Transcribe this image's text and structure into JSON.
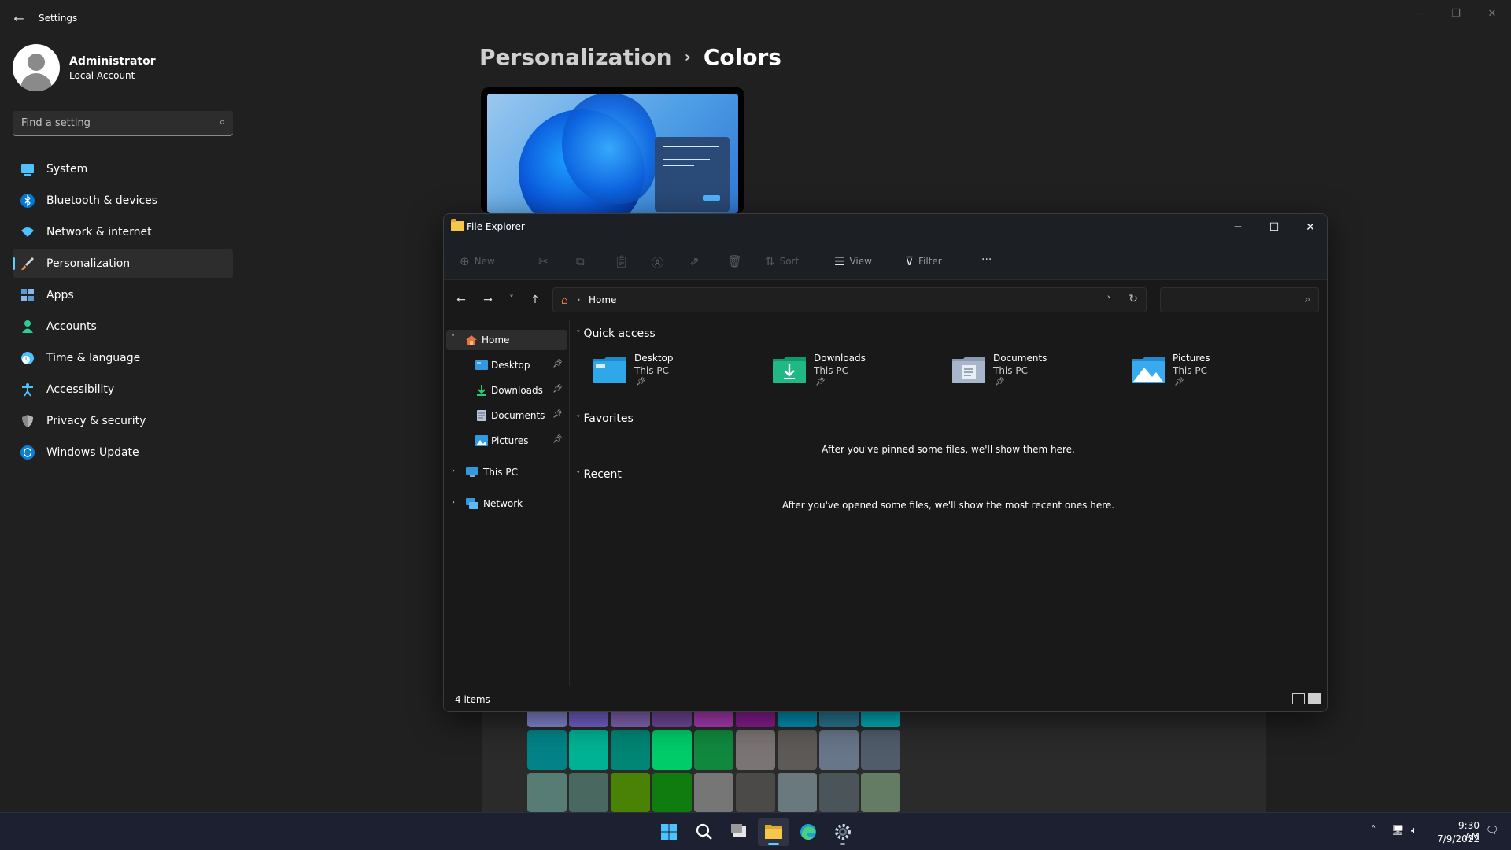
{
  "settings": {
    "title": "Settings",
    "profile": {
      "name": "Administrator",
      "account_type": "Local Account"
    },
    "search": {
      "placeholder": "Find a setting"
    },
    "nav": [
      {
        "label": "System",
        "icon": "system-icon",
        "color": "#4cc2ff"
      },
      {
        "label": "Bluetooth & devices",
        "icon": "bluetooth-icon",
        "color": "#0078d4"
      },
      {
        "label": "Network & internet",
        "icon": "wifi-icon",
        "color": "#4cc2ff"
      },
      {
        "label": "Personalization",
        "icon": "brush-icon",
        "color": "#f0a030",
        "active": true
      },
      {
        "label": "Apps",
        "icon": "apps-icon",
        "color": "#5b9bd5"
      },
      {
        "label": "Accounts",
        "icon": "accounts-icon",
        "color": "#2ecc9a"
      },
      {
        "label": "Time & language",
        "icon": "clock-globe-icon",
        "color": "#4cc2ff"
      },
      {
        "label": "Accessibility",
        "icon": "accessibility-icon",
        "color": "#4cc2ff"
      },
      {
        "label": "Privacy & security",
        "icon": "shield-icon",
        "color": "#8a8a8a"
      },
      {
        "label": "Windows Update",
        "icon": "update-icon",
        "color": "#4cc2ff"
      }
    ],
    "breadcrumb": {
      "parent": "Personalization",
      "separator": "›",
      "current": "Colors"
    },
    "accent_swatches": {
      "row1": [
        "#8c8fe0",
        "#7b68d8",
        "#8e6cc0",
        "#7a4ea8",
        "#b53fc0",
        "#8f1f9a",
        "#0099bc",
        "#2d7d9a",
        "#00b7c3"
      ],
      "row2": [
        "#038387",
        "#00b294",
        "#018574",
        "#00cc6a",
        "#10893e",
        "#7a7574",
        "#5d5a58",
        "#68768a",
        "#515c6b"
      ],
      "row3": [
        "#567c73",
        "#486860",
        "#498205",
        "#107c10",
        "#767676",
        "#4c4a48",
        "#69797e",
        "#4a5459",
        "#647c64"
      ]
    }
  },
  "explorer": {
    "title": "File Explorer",
    "toolbar": {
      "new_label": "New",
      "sort_label": "Sort",
      "view_label": "View",
      "filter_label": "Filter",
      "more_label": "···"
    },
    "address": {
      "path": "Home"
    },
    "search": {
      "placeholder": ""
    },
    "tree": [
      {
        "label": "Home",
        "icon": "home-icon",
        "selected": true,
        "expander": "˅"
      },
      {
        "label": "Desktop",
        "icon": "desktop-icon",
        "pinned": true
      },
      {
        "label": "Downloads",
        "icon": "downloads-icon",
        "pinned": true
      },
      {
        "label": "Documents",
        "icon": "documents-icon",
        "pinned": true
      },
      {
        "label": "Pictures",
        "icon": "pictures-icon",
        "pinned": true
      },
      {
        "label": "This PC",
        "icon": "this-pc-icon",
        "expander": "›"
      },
      {
        "label": "Network",
        "icon": "network-icon",
        "expander": "›"
      }
    ],
    "sections": {
      "quick_access": "Quick access",
      "favorites": "Favorites",
      "recent": "Recent"
    },
    "quick_access": [
      {
        "name": "Desktop",
        "location": "This PC",
        "icon": "desktop-folder-icon"
      },
      {
        "name": "Downloads",
        "location": "This PC",
        "icon": "downloads-folder-icon"
      },
      {
        "name": "Documents",
        "location": "This PC",
        "icon": "documents-folder-icon"
      },
      {
        "name": "Pictures",
        "location": "This PC",
        "icon": "pictures-folder-icon"
      }
    ],
    "favorites_empty": "After you've pinned some files, we'll show them here.",
    "recent_empty": "After you've opened some files, we'll show the most recent ones here.",
    "status": {
      "item_count": "4 items"
    }
  },
  "taskbar": {
    "apps": [
      {
        "name": "start-button",
        "icon": "windows-logo-icon"
      },
      {
        "name": "search-button",
        "icon": "search-icon"
      },
      {
        "name": "task-view-button",
        "icon": "task-view-icon"
      },
      {
        "name": "file-explorer-button",
        "icon": "folder-icon",
        "active": true
      },
      {
        "name": "edge-button",
        "icon": "edge-icon"
      },
      {
        "name": "settings-button",
        "icon": "gear-icon",
        "running": true
      }
    ],
    "clock": {
      "time": "9:30 AM",
      "date": "7/9/2022"
    }
  }
}
